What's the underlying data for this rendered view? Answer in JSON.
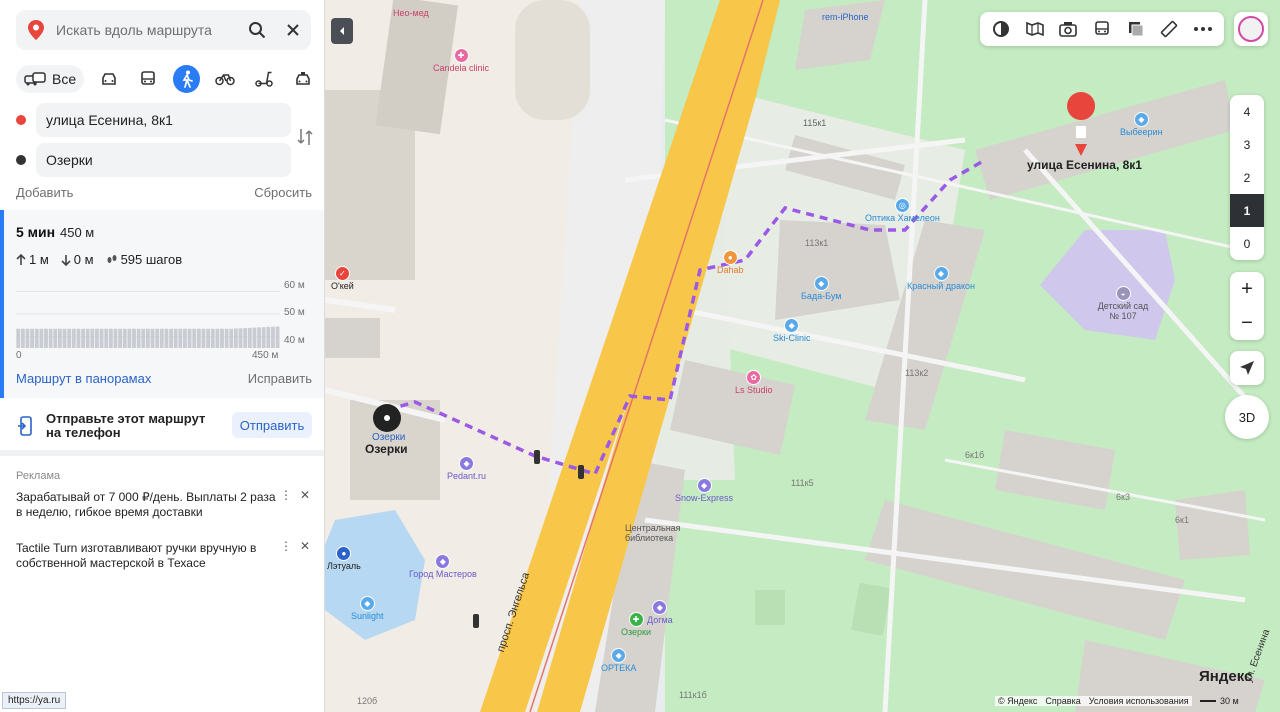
{
  "search": {
    "placeholder": "Искать вдоль маршрута"
  },
  "modes": {
    "all_label": "Все"
  },
  "route": {
    "from": "улица Есенина, 8к1",
    "to": "Озерки",
    "add_label": "Добавить",
    "reset_label": "Сбросить",
    "time": "5 мин",
    "distance": "450 м",
    "ascent": "1 м",
    "descent": "0 м",
    "steps": "595 шагов",
    "panorama_link": "Маршрут в панорамах",
    "fix_link": "Исправить"
  },
  "elevation": {
    "y_labels": [
      "60 м",
      "50 м",
      "40 м"
    ],
    "x_start": "0",
    "x_end": "450 м",
    "profile": [
      43.5,
      43.5,
      43.5,
      43.5,
      43.5,
      43.5,
      43.5,
      43.5,
      43.5,
      43.5,
      43.5,
      43.5,
      43.5,
      43.5,
      43.5,
      43.5,
      43.5,
      43.5,
      43.5,
      43.5,
      43.5,
      43.5,
      43.5,
      43.5,
      43.5,
      43.5,
      43.5,
      43.5,
      43.5,
      43.5,
      43.5,
      43.5,
      43.5,
      43.5,
      43.5,
      43.5,
      43.5,
      43.5,
      43.5,
      43.5,
      43.5,
      43.5,
      43.5,
      43.5,
      43.5,
      43.5,
      43.5,
      43.6,
      43.7,
      43.8,
      43.9,
      44,
      44.1,
      44.2,
      44.3,
      44.4,
      44.5
    ]
  },
  "send": {
    "text": "Отправьте этот маршрут на телефон",
    "button": "Отправить"
  },
  "ads": {
    "label": "Реклама",
    "items": [
      {
        "text": "Зарабатывай от 7 000 ₽/день. Выплаты 2 раза в неделю, гибкое время доставки"
      },
      {
        "text": "Tactile Turn изготавливают ручки вручную в собственной мастерской в Техасе"
      }
    ]
  },
  "status_url": "https://ya.ru",
  "map": {
    "floors": [
      "4",
      "3",
      "2",
      "1",
      "0"
    ],
    "active_floor": "1",
    "zoom_in": "+",
    "zoom_out": "−",
    "btn_3d": "3D",
    "logo_main": "Яндекс",
    "copyright": "© Яндекс",
    "help": "Справка",
    "terms": "Условия использования",
    "scale": "30 м",
    "labels": {
      "neo_med": "Нео-мед",
      "candela": "Candela clinic",
      "rem_iphone": "rem-iPhone",
      "b115k1": "115к1",
      "vybeerin": "Выбеерин",
      "dest": "улица Есенина, 8к1",
      "optika": "Оптика Хамелеон",
      "b113k1": "113к1",
      "dahab": "Dahab",
      "bada_bum": "Бада-Бум",
      "krasny": "Красный дракон",
      "ski": "Ski-Clinic",
      "detsad": "Детский сад № 107",
      "okey": "О'кей",
      "b113k2": "113к2",
      "ls": "Ls Studio",
      "ozerki_metro": "Озерки",
      "ozerki_stop": "Озерки",
      "pedant": "Pedant.ru",
      "b6k1b": "6к1б",
      "b111k5": "111к5",
      "snow": "Snow-Express",
      "b6k3": "6к3",
      "library": "Центральная библиотека",
      "latual": "Лэтуаль",
      "gorod": "Город Мастеров",
      "sunlight": "Sunlight",
      "street": "просп. Энгельса",
      "dogma": "Догма",
      "ozerki_green": "Озерки",
      "orteka": "ОРТЕКА",
      "b111k1b": "111к1б",
      "b120b": "120б",
      "esenina_street": "ул. Есенина",
      "b6k1": "6к1"
    }
  },
  "colors": {
    "accent": "#2a7cf6",
    "route": "#9b59e6",
    "park": "#c4ebc1",
    "road_main": "#f8c74a",
    "destination": "#e8463c"
  }
}
